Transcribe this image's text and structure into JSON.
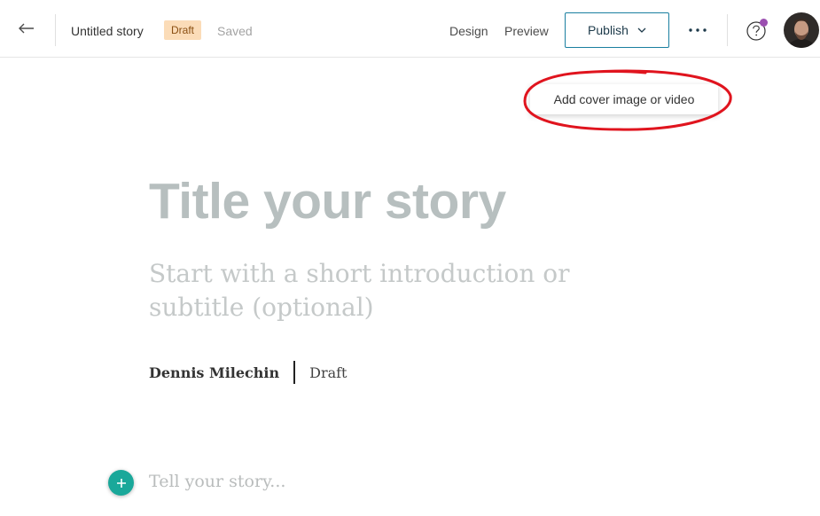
{
  "header": {
    "story_title": "Untitled story",
    "status_badge": "Draft",
    "save_status": "Saved",
    "nav": {
      "design": "Design",
      "preview": "Preview"
    },
    "publish_label": "Publish"
  },
  "cover": {
    "label": "Add cover image or video"
  },
  "story": {
    "title_placeholder": "Title your story",
    "subtitle_placeholder": "Start with a short introduction or subtitle (optional)",
    "author": "Dennis Milechin",
    "status": "Draft",
    "body_placeholder": "Tell your story..."
  },
  "colors": {
    "accent": "#1aa89a",
    "publish_border": "#1a7fa0",
    "draft_badge_bg": "#fbdcb8",
    "notification_dot": "#9b4fb0",
    "annotation": "#e0141e"
  },
  "icons": [
    "back-arrow-icon",
    "chevron-down-icon",
    "more-horizontal-icon",
    "help-icon",
    "plus-icon"
  ]
}
